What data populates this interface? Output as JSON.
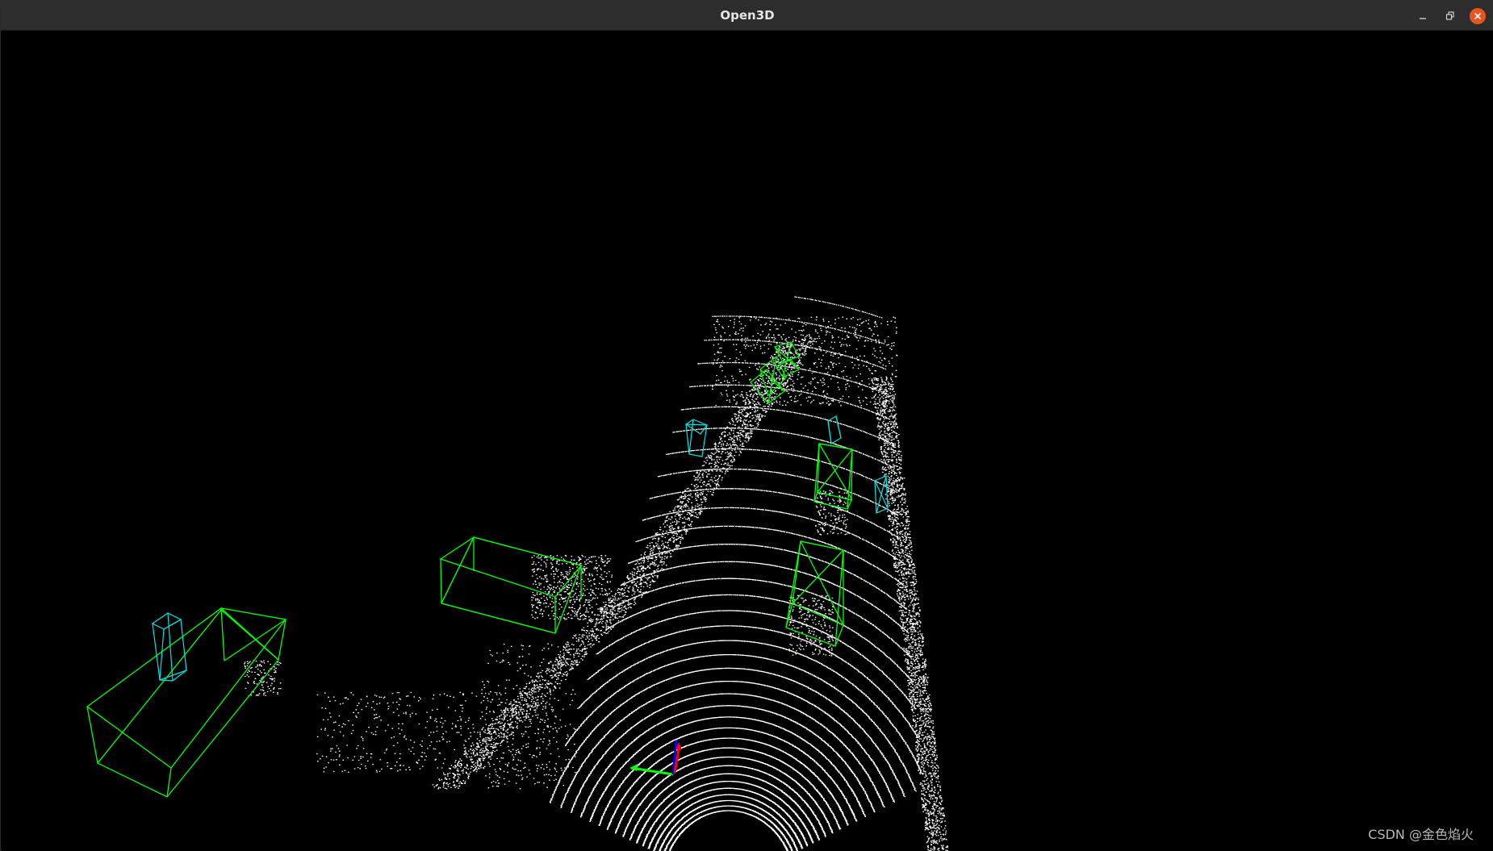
{
  "window": {
    "title": "Open3D",
    "controls": {
      "minimize": "minimize-icon",
      "maximize": "restore-icon",
      "close": "close-icon"
    }
  },
  "viewer": {
    "background": "#000000",
    "point_color": "#ffffff",
    "box_colors": {
      "car": "#00ff00",
      "pedestrian": "#00e5e5"
    },
    "axis_colors": {
      "x": "#ff0000",
      "y": "#00ff00",
      "z": "#0000ff"
    }
  },
  "watermark": "CSDN @金色焰火"
}
